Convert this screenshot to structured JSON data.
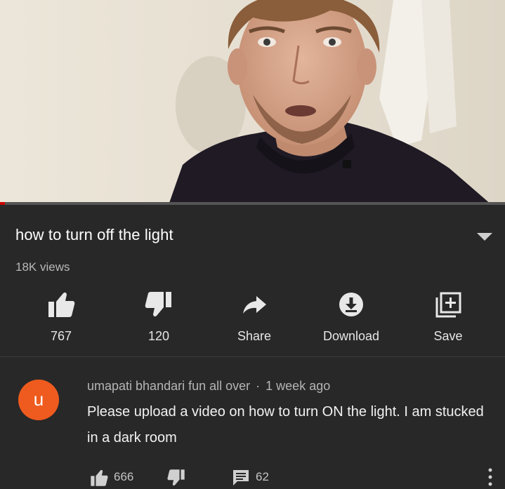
{
  "video": {
    "title": "how to turn off the light",
    "views": "18K views",
    "progress_fraction": 0.01
  },
  "actions": {
    "like_count": "767",
    "dislike_count": "120",
    "share_label": "Share",
    "download_label": "Download",
    "save_label": "Save"
  },
  "comment": {
    "avatar_letter": "u",
    "author": "umapati bhandari fun all over",
    "separator": "·",
    "time": "1 week ago",
    "text": "Please upload a video on how to turn ON the light. I am stucked in a dark room",
    "like_count": "666",
    "reply_count": "62"
  },
  "colors": {
    "background": "#282828",
    "accent_red": "#cc0000",
    "avatar": "#ef5b1e",
    "text_primary": "#ffffff",
    "text_secondary": "#b8b8b8"
  },
  "icons": [
    "like-icon",
    "dislike-icon",
    "share-icon",
    "download-icon",
    "save-icon",
    "reply-icon",
    "more-vert-icon",
    "expand-caret-icon"
  ]
}
